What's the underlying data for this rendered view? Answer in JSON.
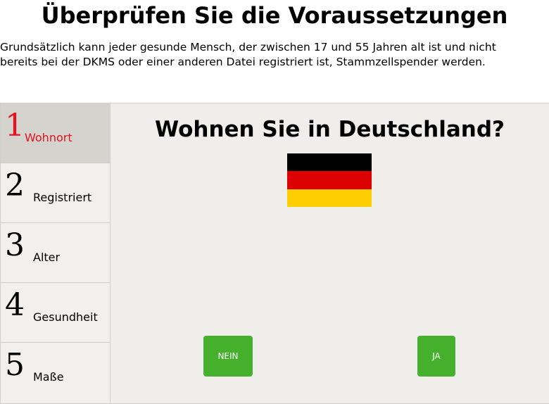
{
  "page": {
    "title": "Überprüfen Sie die Voraussetzungen",
    "intro": "Grundsätzlich kann jeder gesunde Mensch, der zwischen 17 und 55 Jahren alt ist und nicht bereits bei der DKMS oder einer anderen Datei registriert ist, Stammzellspender werden."
  },
  "steps": [
    {
      "number": "1",
      "label": "Wohnort",
      "active": true
    },
    {
      "number": "2",
      "label": "Registriert",
      "active": false
    },
    {
      "number": "3",
      "label": "Alter",
      "active": false
    },
    {
      "number": "4",
      "label": "Gesundheit",
      "active": false
    },
    {
      "number": "5",
      "label": "Maße",
      "active": false
    }
  ],
  "question": {
    "text": "Wohnen Sie in Deutschland?",
    "flag_icon": "germany-flag-icon",
    "flag_colors": [
      "#000000",
      "#dd0000",
      "#ffce00"
    ]
  },
  "buttons": {
    "no_label": "NEIN",
    "yes_label": "JA",
    "color": "#44b02b"
  },
  "colors": {
    "active_step_text": "#e0141e",
    "active_step_bg": "#d4d3cd",
    "panel_bg": "#f0eeeb"
  }
}
